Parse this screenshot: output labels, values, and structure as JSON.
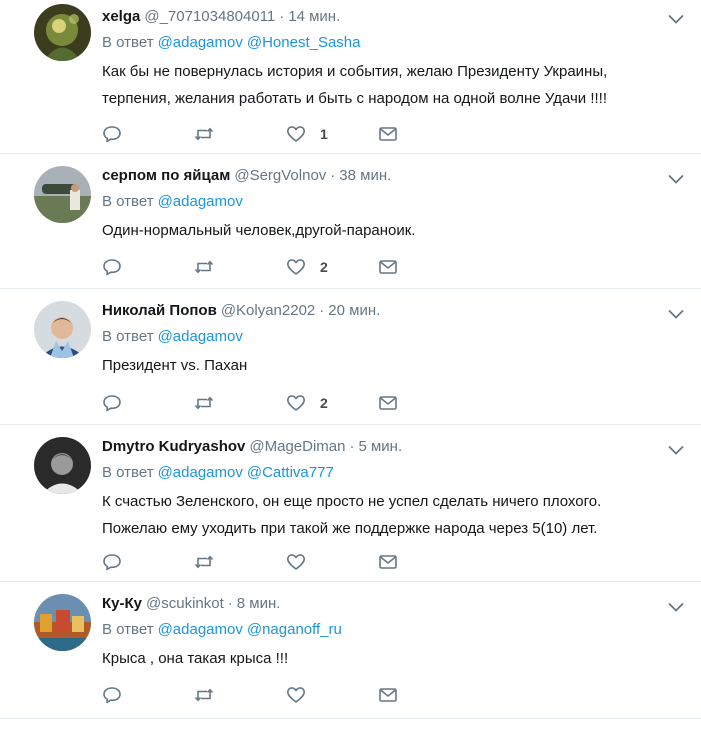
{
  "reply_prefix": "В ответ",
  "colors": {
    "link": "#1b95e0",
    "secondary_text": "#657786",
    "divider": "#e6ecf0"
  },
  "tweets": [
    {
      "fullname": "xelga",
      "username": "@_7071034804011",
      "time": "14 мин.",
      "mentions": [
        "@adagamov",
        "@Honest_Sasha"
      ],
      "text_lines": [
        "Как бы не повернулась  история  и события, желаю Президенту Украины,",
        "терпения, желания  работать и быть с народом на одной  волне Удачи !!!!"
      ],
      "reply_count": "",
      "retweet_count": "",
      "like_count": "1"
    },
    {
      "fullname": "серпом по яйцам",
      "username": "@SergVolnov",
      "time": "38 мин.",
      "mentions": [
        "@adagamov"
      ],
      "text_lines": [
        "Один-нормальный человек,другой-параноик."
      ],
      "reply_count": "",
      "retweet_count": "",
      "like_count": "2"
    },
    {
      "fullname": "Николай Попов",
      "username": "@Kolyan2202",
      "time": "20 мин.",
      "mentions": [
        "@adagamov"
      ],
      "text_lines": [
        "Президент vs. Пахан"
      ],
      "reply_count": "",
      "retweet_count": "",
      "like_count": "2"
    },
    {
      "fullname": "Dmytro Kudryashov",
      "username": "@MageDiman",
      "time": "5 мин.",
      "mentions": [
        "@adagamov",
        "@Cattiva777"
      ],
      "text_lines": [
        "К счастью Зеленского, он еще просто не успел сделать ничего плохого.",
        "Пожелаю ему уходить при такой же поддержке народа через 5(10) лет."
      ],
      "reply_count": "",
      "retweet_count": "",
      "like_count": ""
    },
    {
      "fullname": "Ку-Ку",
      "username": "@scukinkot",
      "time": "8 мин.",
      "mentions": [
        "@adagamov",
        "@naganoff_ru"
      ],
      "text_lines": [
        "Крыса , она такая крыса !!!"
      ],
      "reply_count": "",
      "retweet_count": "",
      "like_count": ""
    }
  ]
}
